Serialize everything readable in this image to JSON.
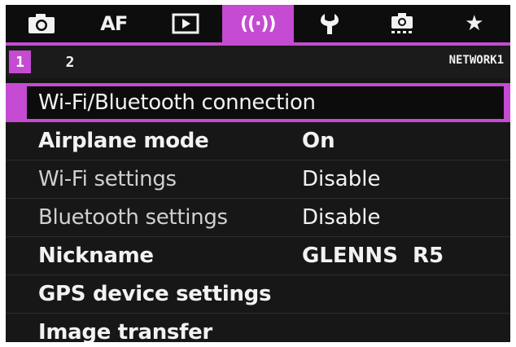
{
  "tabs": [
    {
      "icon": "camera-icon",
      "label": ""
    },
    {
      "icon": "",
      "label": "AF"
    },
    {
      "icon": "playback-icon",
      "label": ""
    },
    {
      "icon": "wireless-icon",
      "label": "((·))"
    },
    {
      "icon": "wrench-icon",
      "label": ""
    },
    {
      "icon": "custom-camera-icon",
      "label": ""
    },
    {
      "icon": "star-icon",
      "label": "★"
    }
  ],
  "active_tab": "wireless",
  "subtabs": [
    "1",
    "2"
  ],
  "page_name": "NETWORK1",
  "menu": [
    {
      "label": "Wi-Fi/Bluetooth connection",
      "value": ""
    },
    {
      "label": "Airplane mode",
      "value": "On"
    },
    {
      "label": "Wi-Fi settings",
      "value": "Disable"
    },
    {
      "label": "Bluetooth settings",
      "value": "Disable"
    },
    {
      "label": "Nickname",
      "value": "GLENNS  R5"
    },
    {
      "label": "GPS device settings",
      "value": ""
    },
    {
      "label": "Image transfer",
      "value": ""
    }
  ],
  "colors": {
    "accent": "#c44bd2",
    "background": "#161616",
    "text": "#f2f2f2"
  }
}
